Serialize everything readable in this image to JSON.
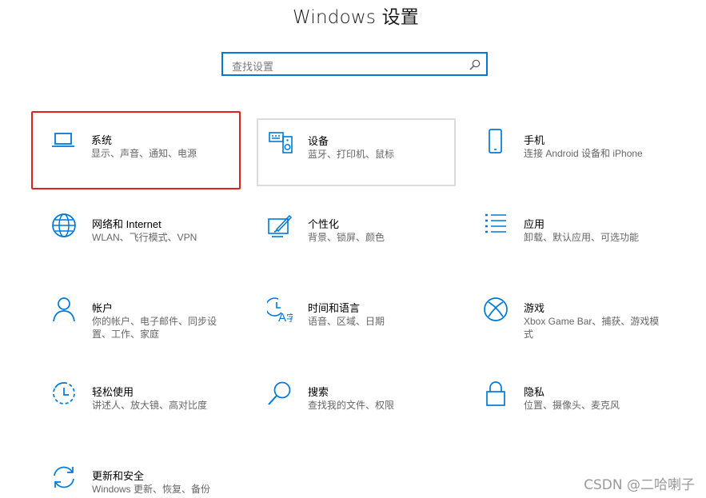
{
  "window": {
    "title": "Windows 设置"
  },
  "search": {
    "placeholder": "查找设置"
  },
  "items": [
    {
      "name": "系统",
      "desc": "显示、声音、通知、电源",
      "icon": "laptop-icon"
    },
    {
      "name": "设备",
      "desc": "蓝牙、打印机、鼠标",
      "icon": "keyboard-speaker-icon"
    },
    {
      "name": "手机",
      "desc": "连接 Android 设备和 iPhone",
      "icon": "phone-icon"
    },
    {
      "name": "网络和 Internet",
      "desc": "WLAN、飞行模式、VPN",
      "icon": "globe-icon"
    },
    {
      "name": "个性化",
      "desc": "背景、锁屏、颜色",
      "icon": "paint-brush-icon"
    },
    {
      "name": "应用",
      "desc": "卸载、默认应用、可选功能",
      "icon": "apps-list-icon"
    },
    {
      "name": "帐户",
      "desc": "你的帐户、电子邮件、同步设置、工作、家庭",
      "icon": "person-icon"
    },
    {
      "name": "时间和语言",
      "desc": "语音、区域、日期",
      "icon": "time-language-icon"
    },
    {
      "name": "游戏",
      "desc": "Xbox Game Bar、捕获、游戏模式",
      "icon": "xbox-icon"
    },
    {
      "name": "轻松使用",
      "desc": "讲述人、放大镜、高对比度",
      "icon": "ease-of-access-icon"
    },
    {
      "name": "搜索",
      "desc": "查找我的文件、权限",
      "icon": "search-icon"
    },
    {
      "name": "隐私",
      "desc": "位置、摄像头、麦克风",
      "icon": "lock-icon"
    },
    {
      "name": "更新和安全",
      "desc": "Windows 更新、恢复、备份",
      "icon": "sync-icon"
    }
  ],
  "watermark": "CSDN @二哈喇子",
  "colors": {
    "accent": "#0078d7",
    "selection_border": "#e0221c"
  }
}
